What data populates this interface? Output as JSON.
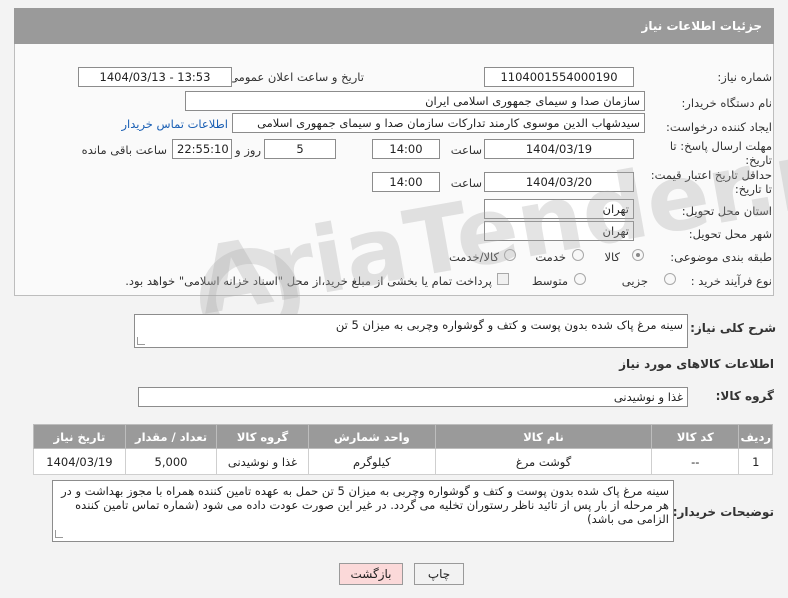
{
  "header": {
    "title": "جزئیات اطلاعات نیاز"
  },
  "fields": {
    "need_number_label": "شماره نیاز:",
    "need_number": "1104001554000190",
    "announce_label": "تاریخ و ساعت اعلان عمومی:",
    "announce_value": "1404/03/13 - 13:53",
    "buyer_org_label": "نام دستگاه خریدار:",
    "buyer_org": "سازمان صدا و سیمای جمهوری اسلامی ایران",
    "requester_label": "ایجاد کننده درخواست:",
    "requester": "سیدشهاب الدین موسوی کارمند تدارکات سازمان صدا و سیمای جمهوری اسلامی",
    "buyer_contact_link": "اطلاعات تماس خریدار",
    "deadline_label_1": "مهلت ارسال پاسخ: تا",
    "deadline_label_2": "تاریخ:",
    "deadline_date": "1404/03/19",
    "time_label": "ساعت",
    "deadline_time": "14:00",
    "days_value": "5",
    "days_label": "روز و",
    "remaining_time": "22:55:10",
    "remaining_label": "ساعت باقی مانده",
    "min_price_label_1": "حداقل تاریخ اعتبار قیمت:",
    "min_price_label_2": "تا تاریخ:",
    "price_valid_date": "1404/03/20",
    "price_valid_time": "14:00",
    "province_label": "استان محل تحویل:",
    "province": "تهران",
    "city_label": "شهر محل تحویل:",
    "city": "تهران",
    "category_label": "طبقه بندی موضوعی:",
    "category_options": [
      "کالا",
      "خدمت",
      "کالا/خدمت"
    ],
    "category_selected": "کالا",
    "process_label": "نوع فرآیند خرید :",
    "process_options": [
      "جزیی",
      "متوسط"
    ],
    "payment_note": "پرداخت تمام یا بخشی از مبلغ خرید،از محل \"اسناد خزانه اسلامی\" خواهد بود."
  },
  "summary": {
    "label": "شرح کلی نیاز:",
    "text": "سینه مرغ پاک شده بدون پوست و کتف و گوشواره وچربی به میزان 5 تن"
  },
  "goods_section": {
    "title": "اطلاعات کالاهای مورد نیاز",
    "group_label": "گروه کالا:",
    "group_value": "غذا و نوشیدنی"
  },
  "table": {
    "headers": [
      "ردیف",
      "کد کالا",
      "نام کالا",
      "واحد شمارش",
      "گروه کالا",
      "تعداد / مقدار",
      "تاریخ نیاز"
    ],
    "rows": [
      [
        "1",
        "--",
        "گوشت مرغ",
        "کیلوگرم",
        "غذا و نوشیدنی",
        "5,000",
        "1404/03/19"
      ]
    ]
  },
  "buyer_notes": {
    "label": "توضیحات خریدار:",
    "text": "سینه مرغ پاک شده بدون پوست و کتف و گوشواره وچربی به میزان 5 تن حمل به عهده تامین کننده همراه با مجوز بهداشت و در هر مرحله از بار پس از تائید ناظر رستوران تخلیه می گردد. در غیر این صورت عودت داده می شود (شماره تماس تامین کننده الزامی می باشد)"
  },
  "buttons": {
    "print": "چاپ",
    "back": "بازگشت"
  },
  "watermark": "AriaTender.neT",
  "colors": {
    "header_bg": "#9a9a9a",
    "back_button_bg": "#fbd9d9",
    "link": "#1a5fb4"
  }
}
